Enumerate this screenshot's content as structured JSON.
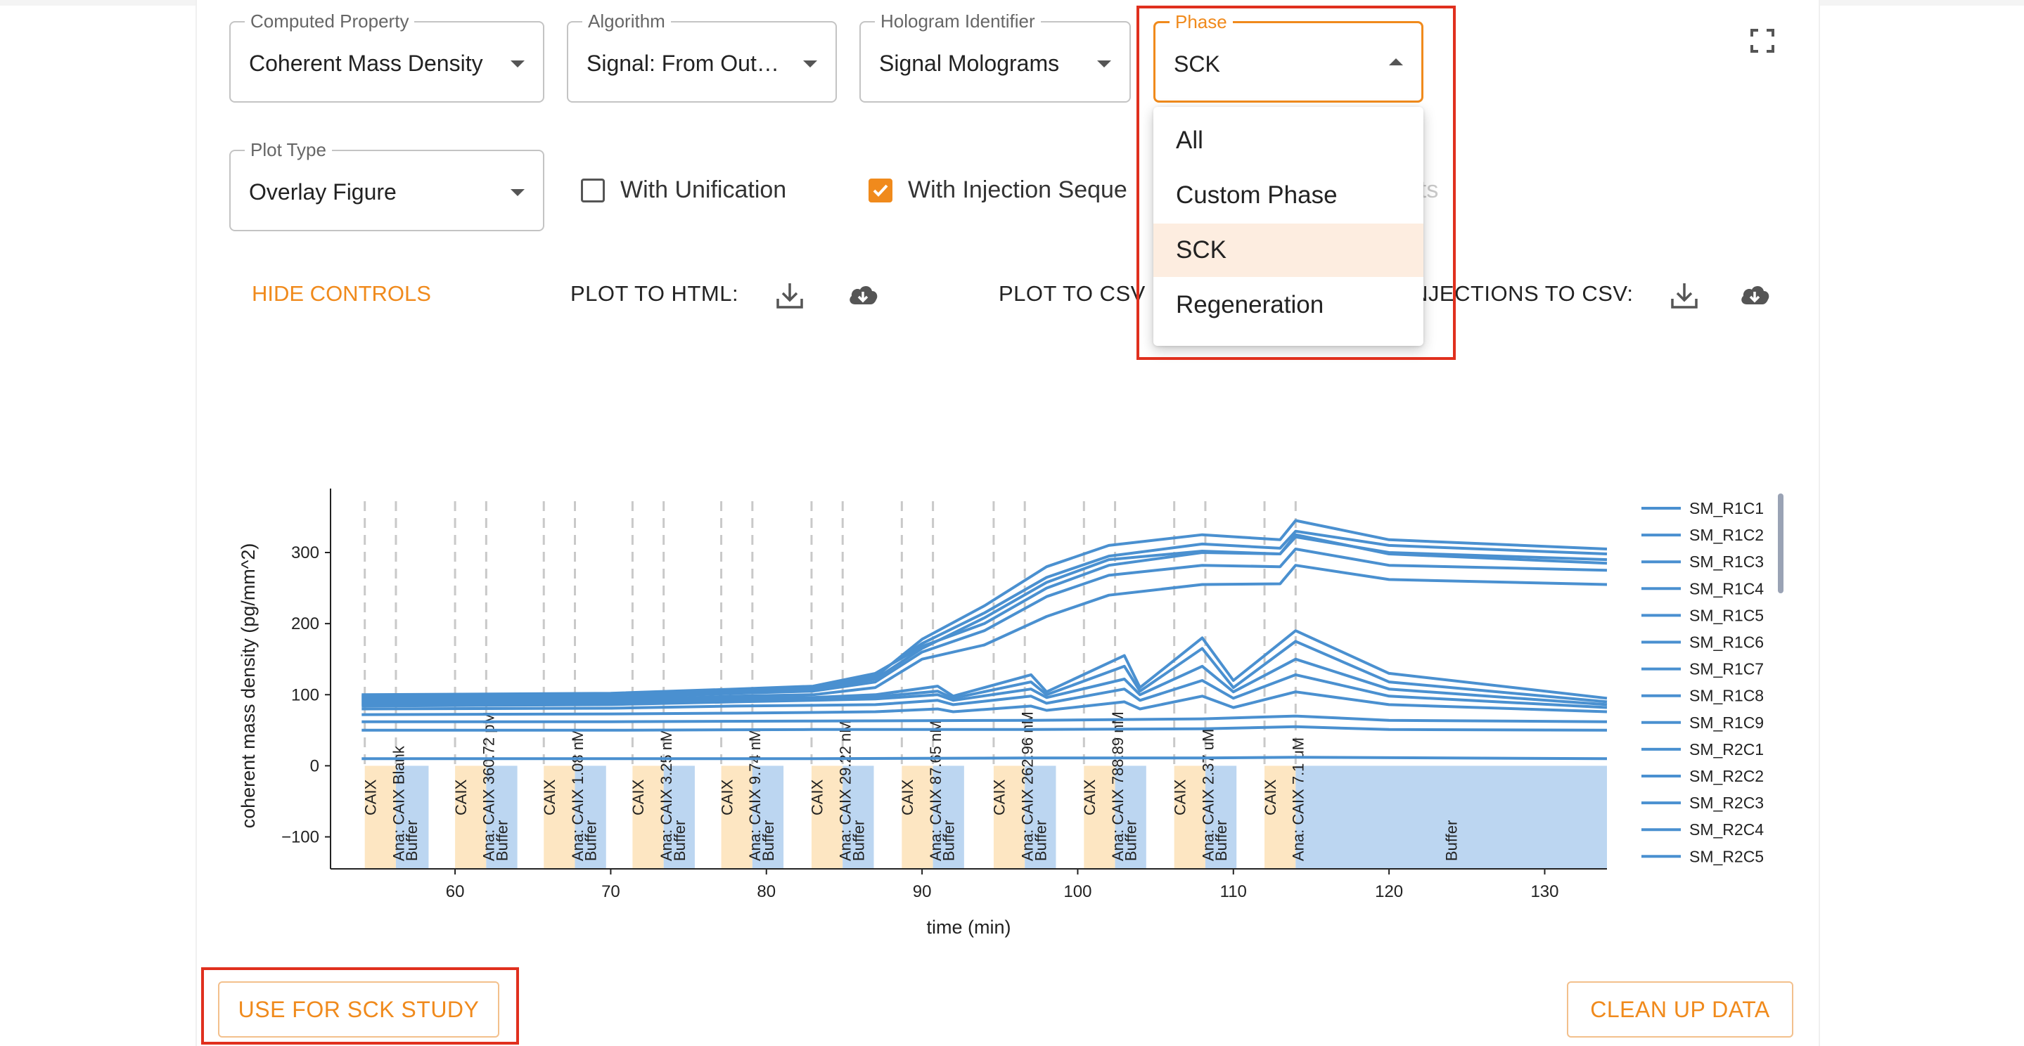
{
  "controls": {
    "computed_property": {
      "label": "Computed Property",
      "value": "Coherent Mass Density"
    },
    "algorithm": {
      "label": "Algorithm",
      "value": "Signal: From Out…"
    },
    "hologram_identifier": {
      "label": "Hologram Identifier",
      "value": "Signal Molograms"
    },
    "phase": {
      "label": "Phase",
      "value": "SCK",
      "expanded": true
    },
    "plot_type": {
      "label": "Plot Type",
      "value": "Overlay Figure"
    },
    "with_unification": {
      "label": "With Unification",
      "checked": false
    },
    "with_injection_sequence": {
      "label": "With Injection Seque",
      "checked": true
    },
    "hidden_fragment": "nts"
  },
  "phase_options": [
    {
      "label": "All",
      "selected": false
    },
    {
      "label": "Custom Phase",
      "selected": false
    },
    {
      "label": "SCK",
      "selected": true
    },
    {
      "label": "Regeneration",
      "selected": false
    }
  ],
  "actions": {
    "hide_controls": "HIDE CONTROLS",
    "plot_to_html": "PLOT TO HTML:",
    "plot_to_csv": "PLOT TO CSV",
    "injections_to_csv": "NJECTIONS TO CSV:",
    "download_icon": "download-icon",
    "cloud_download_icon": "cloud-download-icon"
  },
  "buttons": {
    "use_for_sck_study": "USE FOR SCK STUDY",
    "clean_up_data": "CLEAN UP DATA"
  },
  "colors": {
    "accent": "#f08a1c",
    "highlight_box": "#e0301e",
    "series": "#4a90d0",
    "analyte_band": "#fde6c2",
    "buffer_band": "#bcd6f1"
  },
  "chart_data": {
    "type": "line",
    "xlabel": "time (min)",
    "ylabel": "coherent mass density (pg/mm^2)",
    "x_ticks": [
      60,
      70,
      80,
      90,
      100,
      110,
      120,
      130
    ],
    "y_ticks": [
      -100,
      0,
      100,
      200,
      300
    ],
    "xlim": [
      52,
      134
    ],
    "ylim": [
      -145,
      390
    ],
    "legend_position": "right",
    "legend": [
      "SM_R1C1",
      "SM_R1C2",
      "SM_R1C3",
      "SM_R1C4",
      "SM_R1C5",
      "SM_R1C6",
      "SM_R1C7",
      "SM_R1C8",
      "SM_R1C9",
      "SM_R2C1",
      "SM_R2C2",
      "SM_R2C3",
      "SM_R2C4",
      "SM_R2C5"
    ],
    "injections": [
      {
        "caix": 54.2,
        "ana": 56.2,
        "buf": 58.3,
        "caix_label": "CAIX",
        "ana_label": "Ana: CAIX Blank",
        "buf_label": "Buffer"
      },
      {
        "caix": 60.0,
        "ana": 62.0,
        "buf": 64.0,
        "caix_label": "CAIX",
        "ana_label": "Ana: CAIX 360.72 pM",
        "buf_label": "Buffer"
      },
      {
        "caix": 65.7,
        "ana": 67.7,
        "buf": 69.7,
        "caix_label": "CAIX",
        "ana_label": "Ana: CAIX 1.08 nM",
        "buf_label": "Buffer"
      },
      {
        "caix": 71.4,
        "ana": 73.4,
        "buf": 75.4,
        "caix_label": "CAIX",
        "ana_label": "Ana: CAIX 3.25 nM",
        "buf_label": "Buffer"
      },
      {
        "caix": 77.1,
        "ana": 79.1,
        "buf": 81.1,
        "caix_label": "CAIX",
        "ana_label": "Ana: CAIX 9.74 nM",
        "buf_label": "Buffer"
      },
      {
        "caix": 82.9,
        "ana": 84.9,
        "buf": 86.9,
        "caix_label": "CAIX",
        "ana_label": "Ana: CAIX 29.22 nM",
        "buf_label": "Buffer"
      },
      {
        "caix": 88.7,
        "ana": 90.7,
        "buf": 92.7,
        "caix_label": "CAIX",
        "ana_label": "Ana: CAIX 87.65 nM",
        "buf_label": "Buffer"
      },
      {
        "caix": 94.6,
        "ana": 96.6,
        "buf": 98.6,
        "caix_label": "CAIX",
        "ana_label": "Ana: CAIX 262.96 nM",
        "buf_label": "Buffer"
      },
      {
        "caix": 100.4,
        "ana": 102.4,
        "buf": 104.4,
        "caix_label": "CAIX",
        "ana_label": "Ana: CAIX 788.89 nM",
        "buf_label": "Buffer"
      },
      {
        "caix": 106.2,
        "ana": 108.2,
        "buf": 110.2,
        "caix_label": "CAIX",
        "ana_label": "Ana: CAIX 2.37 uM",
        "buf_label": "Buffer"
      },
      {
        "caix": 112.0,
        "ana": 114.0,
        "buf": 134.0,
        "caix_label": "CAIX",
        "ana_label": "Ana: CAIX 7.1 uM",
        "buf_label": "Buffer"
      }
    ],
    "series": [
      {
        "values": [
          [
            54,
            100
          ],
          [
            70,
            102
          ],
          [
            78,
            108
          ],
          [
            83,
            112
          ],
          [
            87,
            130
          ],
          [
            90,
            168
          ],
          [
            94,
            200
          ],
          [
            98,
            250
          ],
          [
            102,
            282
          ],
          [
            108,
            300
          ],
          [
            113,
            298
          ],
          [
            114,
            322
          ],
          [
            120,
            300
          ],
          [
            134,
            290
          ]
        ]
      },
      {
        "values": [
          [
            54,
            98
          ],
          [
            70,
            100
          ],
          [
            78,
            106
          ],
          [
            83,
            110
          ],
          [
            87,
            128
          ],
          [
            90,
            172
          ],
          [
            94,
            215
          ],
          [
            98,
            265
          ],
          [
            102,
            295
          ],
          [
            108,
            312
          ],
          [
            113,
            306
          ],
          [
            114,
            330
          ],
          [
            120,
            310
          ],
          [
            134,
            298
          ]
        ]
      },
      {
        "values": [
          [
            54,
            96
          ],
          [
            70,
            99
          ],
          [
            78,
            105
          ],
          [
            83,
            108
          ],
          [
            87,
            125
          ],
          [
            90,
            178
          ],
          [
            94,
            225
          ],
          [
            98,
            280
          ],
          [
            102,
            310
          ],
          [
            108,
            325
          ],
          [
            113,
            318
          ],
          [
            114,
            345
          ],
          [
            120,
            318
          ],
          [
            134,
            305
          ]
        ]
      },
      {
        "values": [
          [
            54,
            94
          ],
          [
            70,
            97
          ],
          [
            78,
            104
          ],
          [
            83,
            107
          ],
          [
            87,
            122
          ],
          [
            90,
            165
          ],
          [
            94,
            208
          ],
          [
            98,
            258
          ],
          [
            102,
            290
          ],
          [
            108,
            302
          ],
          [
            113,
            298
          ],
          [
            114,
            325
          ],
          [
            120,
            298
          ],
          [
            134,
            285
          ]
        ]
      },
      {
        "values": [
          [
            54,
            92
          ],
          [
            70,
            95
          ],
          [
            78,
            102
          ],
          [
            83,
            105
          ],
          [
            87,
            118
          ],
          [
            90,
            160
          ],
          [
            94,
            190
          ],
          [
            98,
            238
          ],
          [
            102,
            268
          ],
          [
            108,
            282
          ],
          [
            113,
            280
          ],
          [
            114,
            305
          ],
          [
            120,
            282
          ],
          [
            134,
            275
          ]
        ]
      },
      {
        "values": [
          [
            54,
            90
          ],
          [
            70,
            92
          ],
          [
            78,
            98
          ],
          [
            83,
            100
          ],
          [
            87,
            110
          ],
          [
            90,
            150
          ],
          [
            94,
            170
          ],
          [
            98,
            210
          ],
          [
            102,
            240
          ],
          [
            108,
            255
          ],
          [
            113,
            256
          ],
          [
            114,
            282
          ],
          [
            120,
            262
          ],
          [
            134,
            255
          ]
        ]
      },
      {
        "values": [
          [
            54,
            88
          ],
          [
            70,
            90
          ],
          [
            78,
            95
          ],
          [
            83,
            96
          ],
          [
            87,
            100
          ],
          [
            91,
            112
          ],
          [
            92,
            98
          ],
          [
            97,
            128
          ],
          [
            98,
            104
          ],
          [
            103,
            155
          ],
          [
            104,
            110
          ],
          [
            108,
            180
          ],
          [
            110,
            120
          ],
          [
            114,
            190
          ],
          [
            120,
            130
          ],
          [
            134,
            95
          ]
        ]
      },
      {
        "values": [
          [
            54,
            86
          ],
          [
            70,
            88
          ],
          [
            78,
            92
          ],
          [
            83,
            94
          ],
          [
            87,
            97
          ],
          [
            91,
            105
          ],
          [
            92,
            95
          ],
          [
            97,
            118
          ],
          [
            98,
            100
          ],
          [
            103,
            140
          ],
          [
            104,
            105
          ],
          [
            108,
            165
          ],
          [
            110,
            110
          ],
          [
            114,
            175
          ],
          [
            120,
            118
          ],
          [
            134,
            90
          ]
        ]
      },
      {
        "values": [
          [
            54,
            84
          ],
          [
            70,
            86
          ],
          [
            78,
            90
          ],
          [
            83,
            92
          ],
          [
            87,
            94
          ],
          [
            91,
            100
          ],
          [
            92,
            92
          ],
          [
            97,
            108
          ],
          [
            98,
            96
          ],
          [
            103,
            122
          ],
          [
            104,
            100
          ],
          [
            108,
            140
          ],
          [
            110,
            104
          ],
          [
            114,
            150
          ],
          [
            120,
            108
          ],
          [
            134,
            86
          ]
        ]
      },
      {
        "values": [
          [
            54,
            80
          ],
          [
            70,
            81
          ],
          [
            78,
            84
          ],
          [
            83,
            85
          ],
          [
            87,
            86
          ],
          [
            91,
            92
          ],
          [
            92,
            86
          ],
          [
            97,
            98
          ],
          [
            98,
            88
          ],
          [
            103,
            108
          ],
          [
            104,
            92
          ],
          [
            108,
            120
          ],
          [
            110,
            95
          ],
          [
            114,
            128
          ],
          [
            120,
            98
          ],
          [
            134,
            82
          ]
        ]
      },
      {
        "values": [
          [
            54,
            72
          ],
          [
            70,
            73
          ],
          [
            78,
            74
          ],
          [
            83,
            75
          ],
          [
            87,
            76
          ],
          [
            91,
            80
          ],
          [
            92,
            76
          ],
          [
            97,
            84
          ],
          [
            98,
            78
          ],
          [
            103,
            90
          ],
          [
            104,
            80
          ],
          [
            108,
            98
          ],
          [
            110,
            82
          ],
          [
            114,
            104
          ],
          [
            120,
            86
          ],
          [
            134,
            76
          ]
        ]
      },
      {
        "values": [
          [
            54,
            62
          ],
          [
            70,
            62
          ],
          [
            83,
            63
          ],
          [
            97,
            64
          ],
          [
            108,
            66
          ],
          [
            114,
            70
          ],
          [
            120,
            64
          ],
          [
            134,
            62
          ]
        ]
      },
      {
        "values": [
          [
            54,
            50
          ],
          [
            70,
            50
          ],
          [
            83,
            51
          ],
          [
            97,
            51
          ],
          [
            108,
            52
          ],
          [
            114,
            55
          ],
          [
            120,
            51
          ],
          [
            134,
            50
          ]
        ]
      },
      {
        "values": [
          [
            54,
            10
          ],
          [
            70,
            10
          ],
          [
            83,
            10
          ],
          [
            97,
            11
          ],
          [
            108,
            11
          ],
          [
            114,
            12
          ],
          [
            134,
            10
          ]
        ]
      }
    ]
  }
}
